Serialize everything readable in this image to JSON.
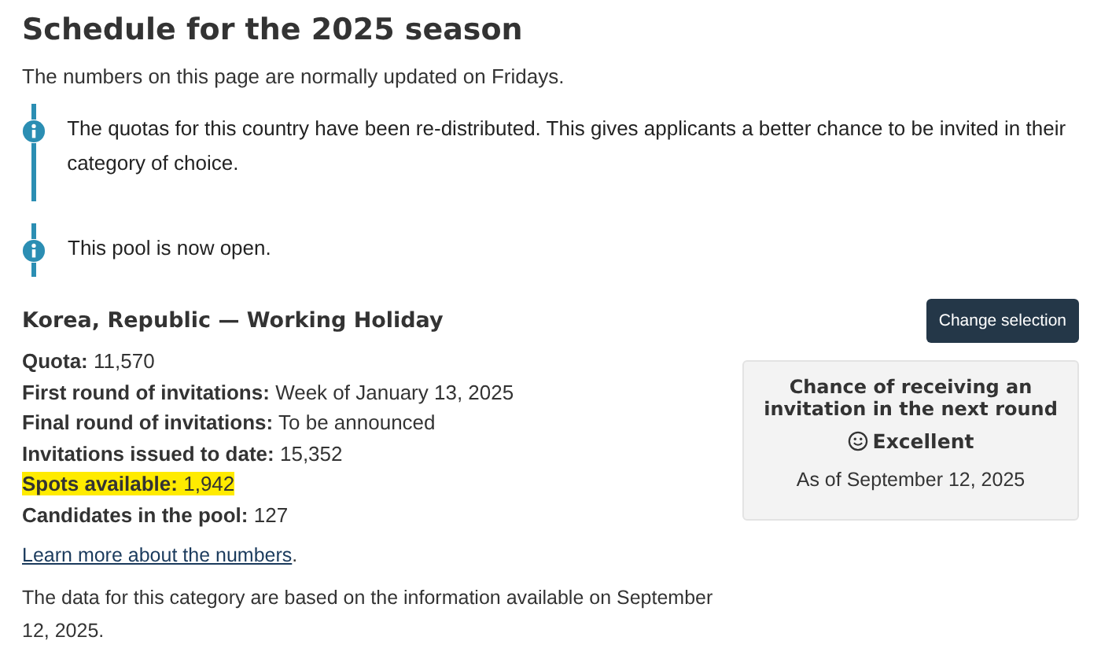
{
  "title": "Schedule for the 2025 season",
  "subtitle": "The numbers on this page are normally updated on Fridays.",
  "alerts": [
    {
      "kind": "info",
      "text": "The quotas for this country have been re-distributed. This gives applicants a better chance to be invited in their category of choice."
    },
    {
      "kind": "info",
      "text": "This pool is now open."
    }
  ],
  "category": {
    "heading": "Korea, Republic — Working Holiday",
    "button": "Change selection"
  },
  "stats": [
    {
      "label": "Quota:",
      "value": "11,570",
      "highlighted": false
    },
    {
      "label": "First round of invitations:",
      "value": "Week of January 13, 2025",
      "highlighted": false
    },
    {
      "label": "Final round of invitations:",
      "value": "To be announced",
      "highlighted": false
    },
    {
      "label": "Invitations issued to date:",
      "value": "15,352",
      "highlighted": false
    },
    {
      "label": "Spots available:",
      "value": "1,942",
      "highlighted": true
    },
    {
      "label": "Candidates in the pool:",
      "value": "127",
      "highlighted": false
    }
  ],
  "learn_more": {
    "link": "Learn more about the numbers",
    "after": "."
  },
  "note": "The data for this category are based on the information available on September 12, 2025.",
  "chance": {
    "title": "Chance of receiving an invitation in the next round",
    "rating": "Excellent",
    "as_of": "As of September 12, 2025"
  }
}
